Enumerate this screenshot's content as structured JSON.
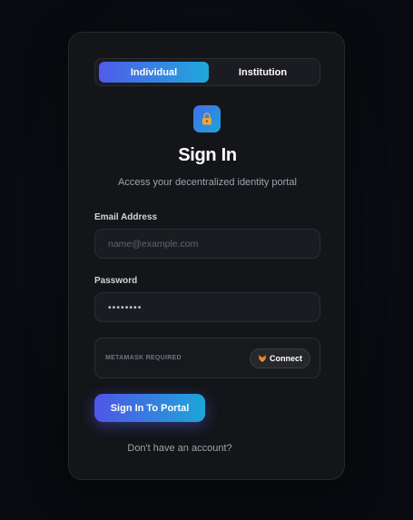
{
  "toggle": {
    "options": [
      "Individual",
      "Institution"
    ],
    "selected": "Individual"
  },
  "header": {
    "icon": "lock-icon",
    "title": "Sign In",
    "subtitle": "Access your decentralized identity portal"
  },
  "form": {
    "email": {
      "label": "Email Address",
      "placeholder": "name@example.com",
      "value": ""
    },
    "password": {
      "label": "Password",
      "value": "••••••••"
    },
    "metamask": {
      "label": "METAMASK REQUIRED",
      "connect_label": "Connect",
      "connect_icon": "fox-icon"
    },
    "submit_label": "Sign In To Portal",
    "signup_text": "Don't have an account?"
  },
  "colors": {
    "accent_start": "#4f5bea",
    "accent_end": "#1fa8dc",
    "background": "#090b10",
    "card": "#141519"
  }
}
